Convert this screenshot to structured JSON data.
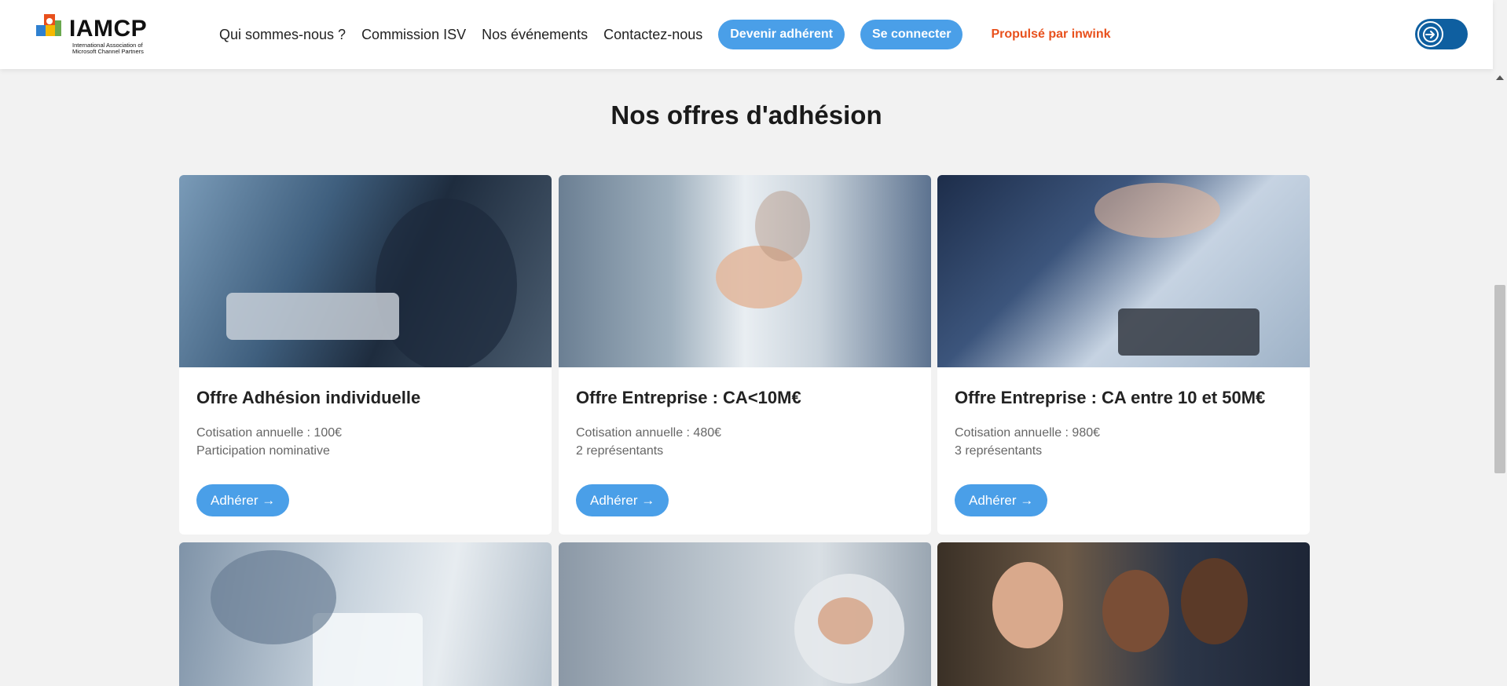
{
  "header": {
    "logo_text": "IAMCP",
    "logo_subtitle": "International Association of Microsoft Channel Partners",
    "nav": [
      "Qui sommes-nous ?",
      "Commission ISV",
      "Nos événements",
      "Contactez-nous"
    ],
    "join_button": "Devenir adhérent",
    "login_button": "Se connecter",
    "powered_by": "Propulsé par inwink",
    "toggle_icon": "login-arrow-icon"
  },
  "main": {
    "title": "Nos offres d'adhésion",
    "cards": [
      {
        "title": "Offre Adhésion individuelle",
        "line1": "Cotisation annuelle : 100€",
        "line2": "Participation nominative",
        "button": "Adhérer →"
      },
      {
        "title": "Offre Entreprise : CA<10M€",
        "line1": "Cotisation annuelle : 480€",
        "line2": "2 représentants",
        "button": "Adhérer →"
      },
      {
        "title": "Offre Entreprise : CA entre 10 et 50M€",
        "line1": "Cotisation annuelle : 980€",
        "line2": "3 représentants",
        "button": "Adhérer →"
      }
    ]
  },
  "colors": {
    "accent": "#4a9fe8",
    "powered": "#e8501c",
    "toggle": "#0f5fa0",
    "background": "#f2f2f2"
  }
}
